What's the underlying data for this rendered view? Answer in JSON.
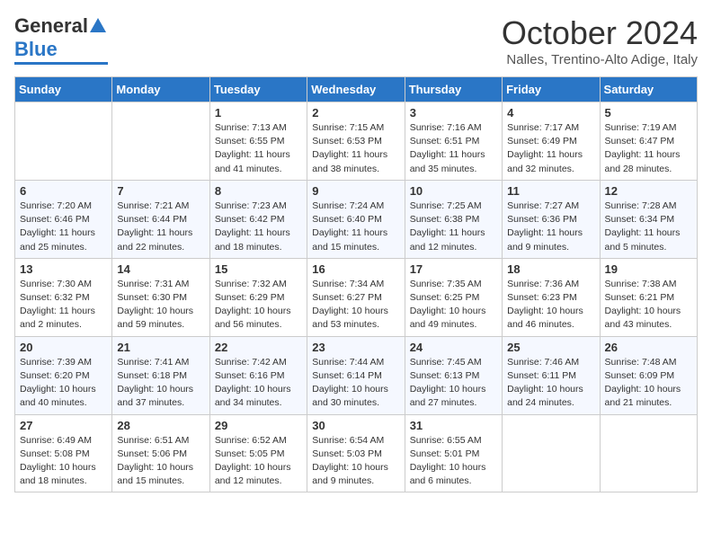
{
  "header": {
    "logo_general": "General",
    "logo_blue": "Blue",
    "month_title": "October 2024",
    "location": "Nalles, Trentino-Alto Adige, Italy"
  },
  "days_of_week": [
    "Sunday",
    "Monday",
    "Tuesday",
    "Wednesday",
    "Thursday",
    "Friday",
    "Saturday"
  ],
  "weeks": [
    [
      {
        "day": "",
        "info": ""
      },
      {
        "day": "",
        "info": ""
      },
      {
        "day": "1",
        "info": "Sunrise: 7:13 AM\nSunset: 6:55 PM\nDaylight: 11 hours and 41 minutes."
      },
      {
        "day": "2",
        "info": "Sunrise: 7:15 AM\nSunset: 6:53 PM\nDaylight: 11 hours and 38 minutes."
      },
      {
        "day": "3",
        "info": "Sunrise: 7:16 AM\nSunset: 6:51 PM\nDaylight: 11 hours and 35 minutes."
      },
      {
        "day": "4",
        "info": "Sunrise: 7:17 AM\nSunset: 6:49 PM\nDaylight: 11 hours and 32 minutes."
      },
      {
        "day": "5",
        "info": "Sunrise: 7:19 AM\nSunset: 6:47 PM\nDaylight: 11 hours and 28 minutes."
      }
    ],
    [
      {
        "day": "6",
        "info": "Sunrise: 7:20 AM\nSunset: 6:46 PM\nDaylight: 11 hours and 25 minutes."
      },
      {
        "day": "7",
        "info": "Sunrise: 7:21 AM\nSunset: 6:44 PM\nDaylight: 11 hours and 22 minutes."
      },
      {
        "day": "8",
        "info": "Sunrise: 7:23 AM\nSunset: 6:42 PM\nDaylight: 11 hours and 18 minutes."
      },
      {
        "day": "9",
        "info": "Sunrise: 7:24 AM\nSunset: 6:40 PM\nDaylight: 11 hours and 15 minutes."
      },
      {
        "day": "10",
        "info": "Sunrise: 7:25 AM\nSunset: 6:38 PM\nDaylight: 11 hours and 12 minutes."
      },
      {
        "day": "11",
        "info": "Sunrise: 7:27 AM\nSunset: 6:36 PM\nDaylight: 11 hours and 9 minutes."
      },
      {
        "day": "12",
        "info": "Sunrise: 7:28 AM\nSunset: 6:34 PM\nDaylight: 11 hours and 5 minutes."
      }
    ],
    [
      {
        "day": "13",
        "info": "Sunrise: 7:30 AM\nSunset: 6:32 PM\nDaylight: 11 hours and 2 minutes."
      },
      {
        "day": "14",
        "info": "Sunrise: 7:31 AM\nSunset: 6:30 PM\nDaylight: 10 hours and 59 minutes."
      },
      {
        "day": "15",
        "info": "Sunrise: 7:32 AM\nSunset: 6:29 PM\nDaylight: 10 hours and 56 minutes."
      },
      {
        "day": "16",
        "info": "Sunrise: 7:34 AM\nSunset: 6:27 PM\nDaylight: 10 hours and 53 minutes."
      },
      {
        "day": "17",
        "info": "Sunrise: 7:35 AM\nSunset: 6:25 PM\nDaylight: 10 hours and 49 minutes."
      },
      {
        "day": "18",
        "info": "Sunrise: 7:36 AM\nSunset: 6:23 PM\nDaylight: 10 hours and 46 minutes."
      },
      {
        "day": "19",
        "info": "Sunrise: 7:38 AM\nSunset: 6:21 PM\nDaylight: 10 hours and 43 minutes."
      }
    ],
    [
      {
        "day": "20",
        "info": "Sunrise: 7:39 AM\nSunset: 6:20 PM\nDaylight: 10 hours and 40 minutes."
      },
      {
        "day": "21",
        "info": "Sunrise: 7:41 AM\nSunset: 6:18 PM\nDaylight: 10 hours and 37 minutes."
      },
      {
        "day": "22",
        "info": "Sunrise: 7:42 AM\nSunset: 6:16 PM\nDaylight: 10 hours and 34 minutes."
      },
      {
        "day": "23",
        "info": "Sunrise: 7:44 AM\nSunset: 6:14 PM\nDaylight: 10 hours and 30 minutes."
      },
      {
        "day": "24",
        "info": "Sunrise: 7:45 AM\nSunset: 6:13 PM\nDaylight: 10 hours and 27 minutes."
      },
      {
        "day": "25",
        "info": "Sunrise: 7:46 AM\nSunset: 6:11 PM\nDaylight: 10 hours and 24 minutes."
      },
      {
        "day": "26",
        "info": "Sunrise: 7:48 AM\nSunset: 6:09 PM\nDaylight: 10 hours and 21 minutes."
      }
    ],
    [
      {
        "day": "27",
        "info": "Sunrise: 6:49 AM\nSunset: 5:08 PM\nDaylight: 10 hours and 18 minutes."
      },
      {
        "day": "28",
        "info": "Sunrise: 6:51 AM\nSunset: 5:06 PM\nDaylight: 10 hours and 15 minutes."
      },
      {
        "day": "29",
        "info": "Sunrise: 6:52 AM\nSunset: 5:05 PM\nDaylight: 10 hours and 12 minutes."
      },
      {
        "day": "30",
        "info": "Sunrise: 6:54 AM\nSunset: 5:03 PM\nDaylight: 10 hours and 9 minutes."
      },
      {
        "day": "31",
        "info": "Sunrise: 6:55 AM\nSunset: 5:01 PM\nDaylight: 10 hours and 6 minutes."
      },
      {
        "day": "",
        "info": ""
      },
      {
        "day": "",
        "info": ""
      }
    ]
  ]
}
